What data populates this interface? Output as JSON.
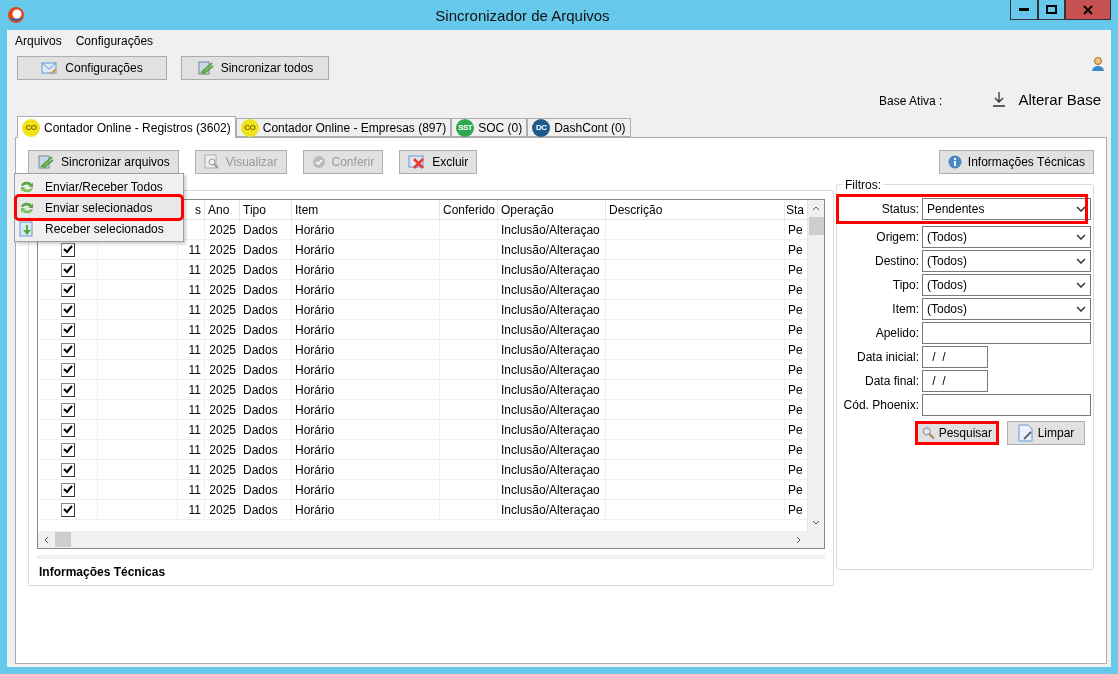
{
  "window": {
    "title": "Sincronizador de Arquivos"
  },
  "menu_bar": [
    "Arquivos",
    "Configurações"
  ],
  "top_buttons": [
    {
      "label": "Configurações",
      "kind": "config"
    },
    {
      "label": "Sincronizar todos",
      "kind": "sync"
    }
  ],
  "base": {
    "label": "Base Ativa :",
    "action": "Alterar Base"
  },
  "tabs": [
    {
      "label": "Contador Online - Registros (3602)",
      "badge": "CO",
      "color": "#f2e21a",
      "selected": true
    },
    {
      "label": "Contador Online - Empresas (897)",
      "badge": "CO",
      "color": "#f2e21a",
      "selected": false
    },
    {
      "label": "SOC (0)",
      "badge": "SST",
      "color": "#2fa84f",
      "selected": false
    },
    {
      "label": "DashCont (0)",
      "badge": "DC",
      "color": "#1f5a8c",
      "selected": false
    }
  ],
  "toolbar": [
    {
      "label": "Sincronizar arquivos",
      "kind": "sync",
      "disabled": false
    },
    {
      "label": "Visualizar",
      "kind": "view",
      "disabled": true
    },
    {
      "label": "Conferir",
      "kind": "check",
      "disabled": true
    },
    {
      "label": "Excluir",
      "kind": "delete",
      "disabled": false
    }
  ],
  "info_button": "Informações Técnicas",
  "dropdown_menu": [
    {
      "label": "Enviar/Receber Todos",
      "kind": "sync",
      "highlighted": false
    },
    {
      "label": "Enviar selecionados",
      "kind": "sync",
      "highlighted": true
    },
    {
      "label": "Receber selecionados",
      "kind": "receive",
      "highlighted": false
    }
  ],
  "table": {
    "columns": [
      "s",
      "Ano",
      "Tipo",
      "Item",
      "Conferido",
      "Operação",
      "Descrição",
      "Sta"
    ],
    "rows": [
      {
        "column_3": "",
        "ano": "2025",
        "tipo": "Dados",
        "item": "Horário",
        "operacao": "Inclusão/Alteraçao",
        "status": "Pe"
      },
      {
        "checked": true,
        "column_3": "11",
        "ano": "2025",
        "tipo": "Dados",
        "item": "Horário",
        "operacao": "Inclusão/Alteraçao",
        "status": "Pe"
      },
      {
        "checked": true,
        "column_3": "11",
        "ano": "2025",
        "tipo": "Dados",
        "item": "Horário",
        "operacao": "Inclusão/Alteraçao",
        "status": "Pe"
      },
      {
        "checked": true,
        "column_3": "11",
        "ano": "2025",
        "tipo": "Dados",
        "item": "Horário",
        "operacao": "Inclusão/Alteraçao",
        "status": "Pe"
      },
      {
        "checked": true,
        "column_3": "11",
        "ano": "2025",
        "tipo": "Dados",
        "item": "Horário",
        "operacao": "Inclusão/Alteraçao",
        "status": "Pe"
      },
      {
        "checked": true,
        "column_3": "11",
        "ano": "2025",
        "tipo": "Dados",
        "item": "Horário",
        "operacao": "Inclusão/Alteraçao",
        "status": "Pe"
      },
      {
        "checked": true,
        "column_3": "11",
        "ano": "2025",
        "tipo": "Dados",
        "item": "Horário",
        "operacao": "Inclusão/Alteraçao",
        "status": "Pe"
      },
      {
        "checked": true,
        "column_3": "11",
        "ano": "2025",
        "tipo": "Dados",
        "item": "Horário",
        "operacao": "Inclusão/Alteraçao",
        "status": "Pe"
      },
      {
        "checked": true,
        "column_3": "11",
        "ano": "2025",
        "tipo": "Dados",
        "item": "Horário",
        "operacao": "Inclusão/Alteraçao",
        "status": "Pe"
      },
      {
        "checked": true,
        "column_3": "11",
        "ano": "2025",
        "tipo": "Dados",
        "item": "Horário",
        "operacao": "Inclusão/Alteraçao",
        "status": "Pe"
      },
      {
        "checked": true,
        "column_3": "11",
        "ano": "2025",
        "tipo": "Dados",
        "item": "Horário",
        "operacao": "Inclusão/Alteraçao",
        "status": "Pe"
      },
      {
        "checked": true,
        "column_3": "11",
        "ano": "2025",
        "tipo": "Dados",
        "item": "Horário",
        "operacao": "Inclusão/Alteraçao",
        "status": "Pe"
      },
      {
        "checked": true,
        "column_3": "11",
        "ano": "2025",
        "tipo": "Dados",
        "item": "Horário",
        "operacao": "Inclusão/Alteraçao",
        "status": "Pe"
      },
      {
        "checked": true,
        "column_3": "11",
        "ano": "2025",
        "tipo": "Dados",
        "item": "Horário",
        "operacao": "Inclusão/Alteraçao",
        "status": "Pe"
      },
      {
        "checked": true,
        "column_3": "11",
        "ano": "2025",
        "tipo": "Dados",
        "item": "Horário",
        "operacao": "Inclusão/Alteraçao",
        "status": "Pe"
      }
    ]
  },
  "info_panel": {
    "title": "Informações Técnicas"
  },
  "filters": {
    "title": "Filtros:",
    "fields": [
      {
        "label": "Status:",
        "kind": "select",
        "value": "Pendentes",
        "highlighted": true
      },
      {
        "label": "Origem:",
        "kind": "select",
        "value": "(Todos)",
        "highlighted": false
      },
      {
        "label": "Destino:",
        "kind": "select",
        "value": "(Todos)",
        "highlighted": false
      },
      {
        "label": "Tipo:",
        "kind": "select",
        "value": "(Todos)",
        "highlighted": false
      },
      {
        "label": "Item:",
        "kind": "select",
        "value": "(Todos)",
        "highlighted": false
      },
      {
        "label": "Apelido:",
        "kind": "text",
        "highlighted": false
      },
      {
        "label": "Data inicial:",
        "kind": "date",
        "value": " /  /",
        "highlighted": false
      },
      {
        "label": "Data final:",
        "kind": "date",
        "value": " /  /",
        "highlighted": false
      },
      {
        "label": "Cód. Phoenix:",
        "kind": "text",
        "highlighted": false
      }
    ],
    "buttons": [
      {
        "label": "Pesquisar",
        "kind": "search",
        "highlighted": true
      },
      {
        "label": "Limpar",
        "kind": "clear",
        "highlighted": false
      }
    ]
  }
}
